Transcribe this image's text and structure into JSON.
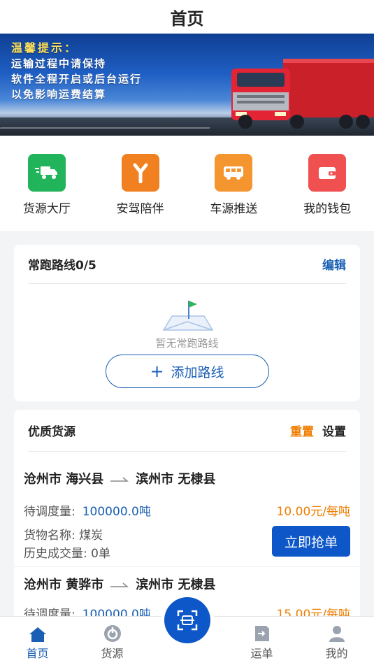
{
  "header": {
    "title": "首页"
  },
  "banner": {
    "lines": [
      "温馨提示：",
      "运输过程中请保持",
      "软件全程开启或后台运行",
      "以免影响运费结算"
    ]
  },
  "quick_menu": [
    {
      "label": "货源大厅",
      "icon": "truck-fast-icon",
      "color": "#22b45a"
    },
    {
      "label": "安驾陪伴",
      "icon": "road-fork-icon",
      "color": "#f08020"
    },
    {
      "label": "车源推送",
      "icon": "bus-icon",
      "color": "#f59530"
    },
    {
      "label": "我的钱包",
      "icon": "wallet-icon",
      "color": "#f05050"
    }
  ],
  "routes": {
    "title": "常跑路线0/5",
    "edit_label": "编辑",
    "empty_text": "暂无常跑路线",
    "add_label": "添加路线"
  },
  "goods": {
    "title": "优质货源",
    "reset_label": "重置",
    "settings_label": "设置",
    "items": [
      {
        "from": "沧州市 海兴县",
        "to": "滨州市 无棣县",
        "qty_label": "待调度量:",
        "qty": "100000.0吨",
        "price": "10.00元/每吨",
        "goods_label": "货物名称: 煤炭",
        "history_label": "历史成交量: 0单",
        "grab_label": "立即抢单"
      },
      {
        "from": "沧州市 黄骅市",
        "to": "滨州市 无棣县",
        "qty_label": "待调度量:",
        "qty": "100000.0吨",
        "price": "15.00元/每吨"
      }
    ]
  },
  "tabbar": {
    "tabs": [
      {
        "label": "首页",
        "icon": "home-icon",
        "active": true
      },
      {
        "label": "货源",
        "icon": "cargo-source-icon",
        "active": false
      },
      {
        "label": "运单",
        "icon": "waybill-icon",
        "active": false
      },
      {
        "label": "我的",
        "icon": "user-icon",
        "active": false
      }
    ],
    "scan_icon": "scan-icon"
  },
  "colors": {
    "primary": "#0d57c8",
    "accent": "#ef7d00",
    "link": "#1a5fb4"
  }
}
